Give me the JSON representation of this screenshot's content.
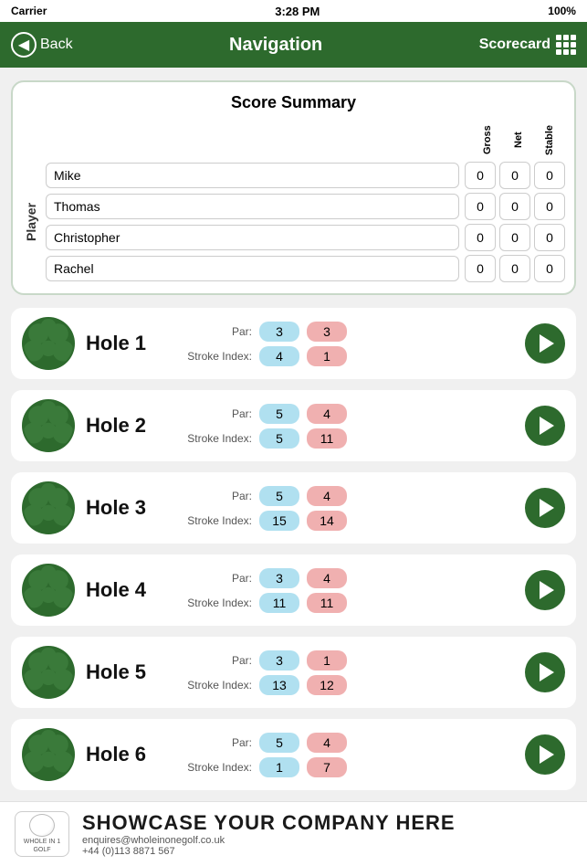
{
  "statusBar": {
    "carrier": "Carrier",
    "wifi": "wifi",
    "time": "3:28 PM",
    "battery": "100%"
  },
  "navBar": {
    "backLabel": "Back",
    "title": "Navigation",
    "scorecardLabel": "Scorecard"
  },
  "scoreSummary": {
    "title": "Score Summary",
    "playerLabel": "Player",
    "headers": [
      "Gross",
      "Net",
      "Stable"
    ],
    "players": [
      {
        "name": "Mike",
        "gross": "0",
        "net": "0",
        "stable": "0"
      },
      {
        "name": "Thomas",
        "gross": "0",
        "net": "0",
        "stable": "0"
      },
      {
        "name": "Christopher",
        "gross": "0",
        "net": "0",
        "stable": "0"
      },
      {
        "name": "Rachel",
        "gross": "0",
        "net": "0",
        "stable": "0"
      }
    ]
  },
  "holes": [
    {
      "name": "Hole 1",
      "par": "3",
      "parAlt": "3",
      "strokeIndex": "4",
      "strokeIndexAlt": "1"
    },
    {
      "name": "Hole 2",
      "par": "5",
      "parAlt": "4",
      "strokeIndex": "5",
      "strokeIndexAlt": "11"
    },
    {
      "name": "Hole 3",
      "par": "5",
      "parAlt": "4",
      "strokeIndex": "15",
      "strokeIndexAlt": "14"
    },
    {
      "name": "Hole 4",
      "par": "3",
      "parAlt": "4",
      "strokeIndex": "11",
      "strokeIndexAlt": "11"
    },
    {
      "name": "Hole 5",
      "par": "3",
      "parAlt": "1",
      "strokeIndex": "13",
      "strokeIndexAlt": "12"
    },
    {
      "name": "Hole 6",
      "par": "5",
      "parAlt": "4",
      "strokeIndex": "1",
      "strokeIndexAlt": "7"
    }
  ],
  "labels": {
    "par": "Par:",
    "strokeIndex": "Stroke Index:"
  },
  "footer": {
    "logoText": "WHOLE IN 1 GOLF",
    "showcase": "SHOWCASE YOUR COMPANY HERE",
    "email": "enquires@wholeinonegolf.co.uk",
    "phone": "+44 (0)113 8871 567"
  }
}
